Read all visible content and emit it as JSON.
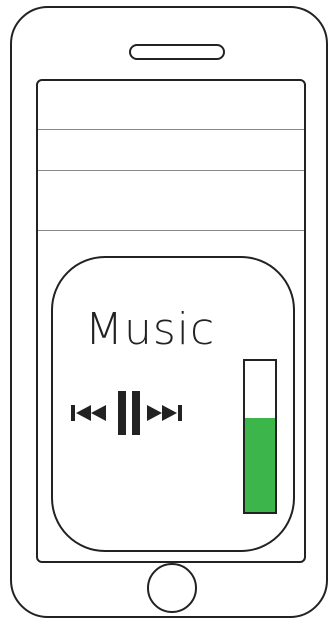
{
  "widget": {
    "title": "Music",
    "controls": [
      {
        "name": "previous",
        "icon": "skip-previous-icon"
      },
      {
        "name": "pause",
        "icon": "pause-icon"
      },
      {
        "name": "next",
        "icon": "skip-next-icon"
      }
    ],
    "volume": {
      "level": 0.62,
      "fill_color": "#3cb64a"
    }
  },
  "colors": {
    "outline": "#222222",
    "divider": "#888888",
    "accent": "#3cb64a"
  }
}
